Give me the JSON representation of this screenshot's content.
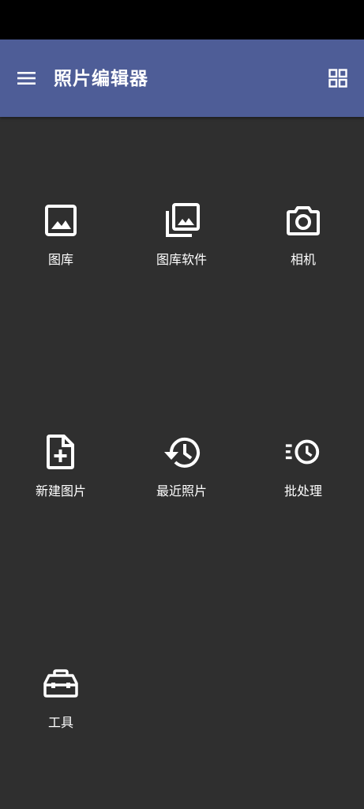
{
  "app_bar": {
    "title": "照片编辑器",
    "menu_icon": "menu-icon",
    "view_icon": "grid-view-icon",
    "background_color": "#4e5d97"
  },
  "tiles": [
    {
      "label": "图库",
      "icon": "image-icon"
    },
    {
      "label": "图库软件",
      "icon": "photo-library-icon"
    },
    {
      "label": "相机",
      "icon": "camera-icon"
    },
    {
      "label": "新建图片",
      "icon": "new-file-icon"
    },
    {
      "label": "最近照片",
      "icon": "history-icon"
    },
    {
      "label": "批处理",
      "icon": "batch-clock-icon"
    },
    {
      "label": "工具",
      "icon": "toolbox-icon"
    }
  ],
  "colors": {
    "background": "#2f2f2f",
    "status_bar": "#000000",
    "icon": "#ffffff"
  }
}
